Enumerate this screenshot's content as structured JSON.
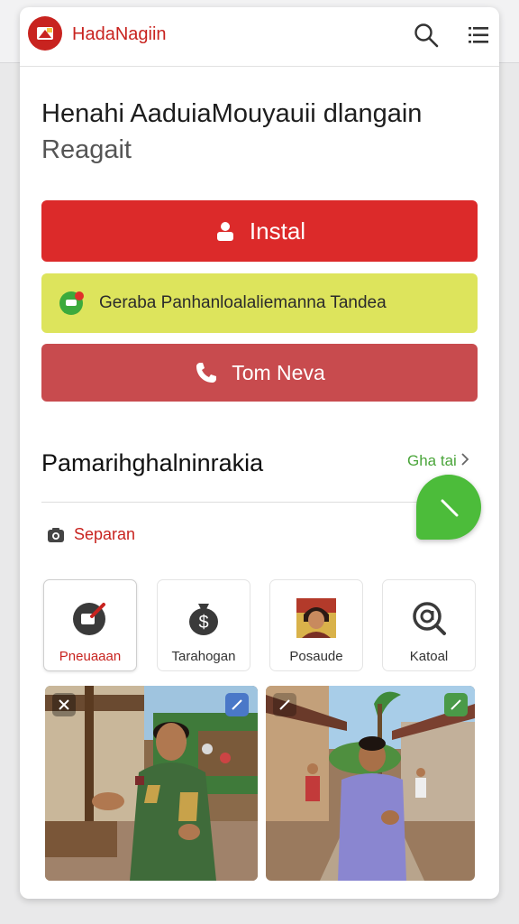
{
  "app": {
    "brand": "HadaNagiin"
  },
  "headline": {
    "line1": "Henahi AaduiaMouyauii dlangain",
    "line2": "Reagait"
  },
  "actions": {
    "install_label": "Instal",
    "chat_label": "Geraba Panhanloalaliemanna Tandea",
    "call_label": "Tom Neva"
  },
  "section": {
    "title": "Pamarihghalninrakia",
    "see_all": "Gha tai"
  },
  "filter": {
    "label": "Separan"
  },
  "categories": [
    {
      "label": "Pneuaaan",
      "icon": "edit-badge-icon",
      "active": true
    },
    {
      "label": "Tarahogan",
      "icon": "money-bag-icon",
      "active": false
    },
    {
      "label": "Posaude",
      "icon": "avatar-photo-icon",
      "active": false
    },
    {
      "label": "Katoal",
      "icon": "at-search-icon",
      "active": false
    }
  ],
  "photos": [
    {
      "name": "photo-market-speaker",
      "close_icon": "close-icon",
      "badge_icon": "expand-icon"
    },
    {
      "name": "photo-village-street",
      "badge_icon": "expand-icon"
    }
  ],
  "colors": {
    "brand_red": "#c8231f",
    "install_red": "#dc2a2a",
    "chat_yellow": "#dde45c",
    "call_red": "#c84b4e",
    "accent_green": "#4cbc3a"
  }
}
